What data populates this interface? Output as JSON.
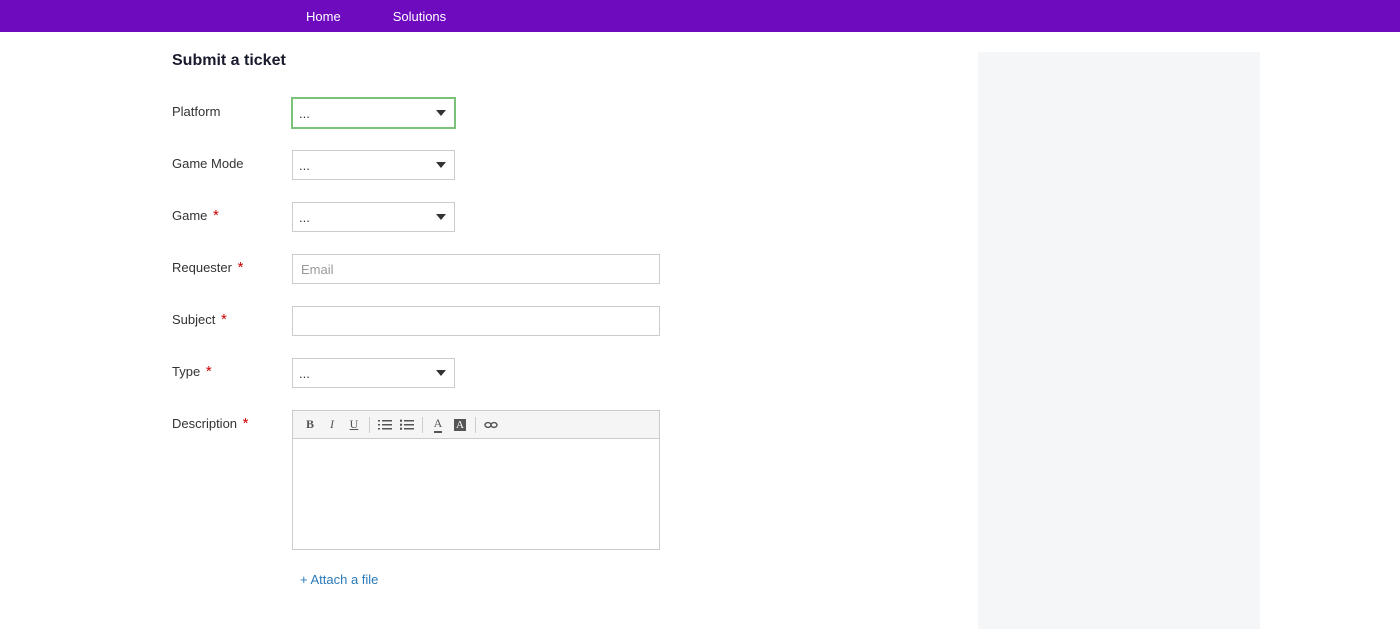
{
  "nav": {
    "home": "Home",
    "solutions": "Solutions"
  },
  "page": {
    "title": "Submit a ticket"
  },
  "fields": {
    "platform": {
      "label": "Platform",
      "value": "..."
    },
    "game_mode": {
      "label": "Game Mode",
      "value": "..."
    },
    "game": {
      "label": "Game",
      "value": "..."
    },
    "requester": {
      "label": "Requester",
      "placeholder": "Email",
      "value": ""
    },
    "subject": {
      "label": "Subject",
      "value": ""
    },
    "type": {
      "label": "Type",
      "value": "..."
    },
    "description": {
      "label": "Description"
    }
  },
  "attach": "+ Attach a file",
  "required_marker": "*"
}
